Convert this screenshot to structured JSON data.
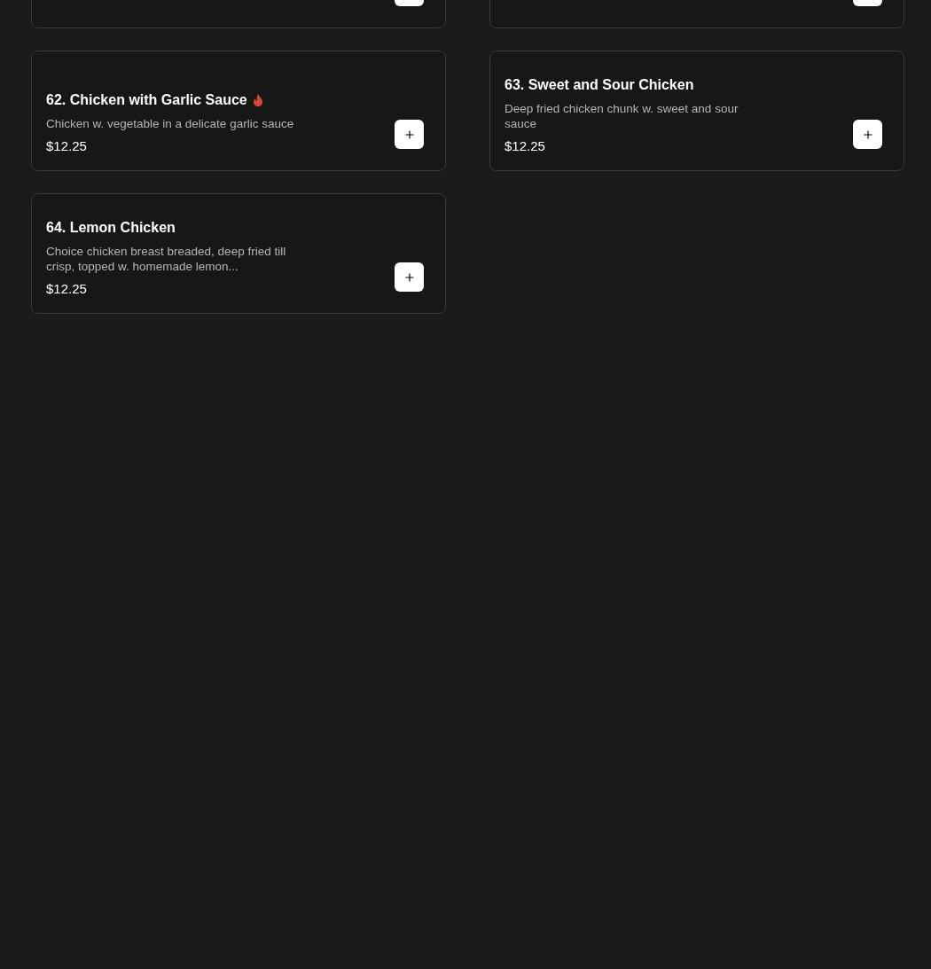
{
  "menu_items": [
    {
      "kind": "partial"
    },
    {
      "kind": "partial"
    },
    {
      "kind": "full",
      "name": "62. Chicken with Garlic Sauce",
      "spicy": true,
      "description": "Chicken w. vegetable in a delicate garlic sauce",
      "price": "$12.25"
    },
    {
      "kind": "full",
      "name": "63. Sweet and Sour Chicken",
      "spicy": false,
      "description": "Deep fried chicken chunk w. sweet and sour sauce",
      "price": "$12.25"
    },
    {
      "kind": "full",
      "name": "64. Lemon Chicken",
      "spicy": false,
      "description": "Choice chicken breast breaded, deep fried till crisp, topped w. homemade lemon...",
      "price": "$12.25"
    }
  ]
}
